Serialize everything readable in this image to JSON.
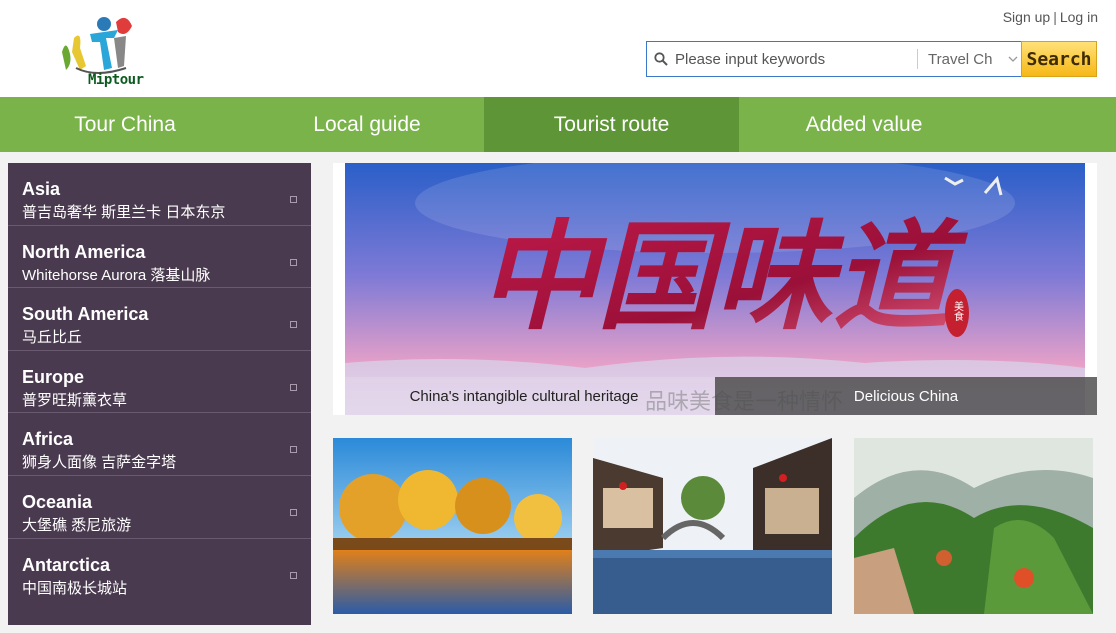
{
  "brand": {
    "logo_text": "Miptour"
  },
  "auth": {
    "signup": "Sign up",
    "separator": "|",
    "login": "Log in"
  },
  "search": {
    "placeholder": "Please input keywords",
    "category": "Travel Ch",
    "button": "Search"
  },
  "nav": {
    "items": [
      {
        "label": "Tour China"
      },
      {
        "label": "Local guide"
      },
      {
        "label": "Tourist route"
      },
      {
        "label": "Added value"
      }
    ],
    "active_index": 2
  },
  "sidebar": {
    "items": [
      {
        "title": "Asia",
        "sub": "普吉岛奢华 斯里兰卡 日本东京"
      },
      {
        "title": "North America",
        "sub": "Whitehorse Aurora 落基山脉"
      },
      {
        "title": "South America",
        "sub": "马丘比丘"
      },
      {
        "title": "Europe",
        "sub": "普罗旺斯薰衣草"
      },
      {
        "title": "Africa",
        "sub": "狮身人面像 吉萨金字塔"
      },
      {
        "title": "Oceania",
        "sub": "大堡礁 悉尼旅游"
      },
      {
        "title": "Antarctica",
        "sub": "中国南极长城站"
      }
    ]
  },
  "banner": {
    "calligraphy": "中国味道",
    "stamp": "美食",
    "watermark": "品味美食是一种情怀",
    "captions": [
      "China's intangible cultural heritage",
      "Delicious China"
    ]
  },
  "colors": {
    "nav_green": "#79b34a",
    "nav_active": "#5e9637",
    "sidebar_bg": "#4a3a4f",
    "search_border": "#3c78c8",
    "search_button": "#f6b817"
  }
}
